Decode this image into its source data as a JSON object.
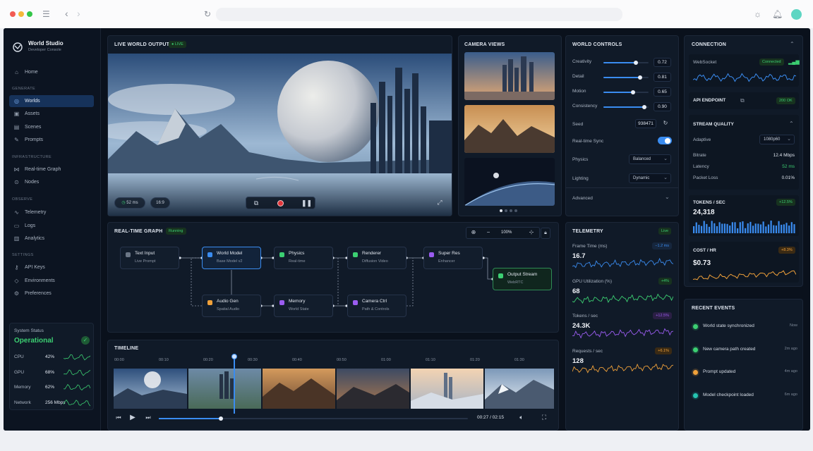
{
  "colors": {
    "accent": "#3a8cf0",
    "success": "#3ccf72",
    "warning": "#f0a13a",
    "purple": "#9a5cf0",
    "teal": "#25c4b0"
  },
  "app": {
    "name": "World Studio",
    "subtitle": "Developer Console"
  },
  "sidebar": {
    "home": "Home",
    "sections": [
      {
        "title": "GENERATE",
        "items": [
          "Worlds",
          "Assets",
          "Scenes",
          "Prompts"
        ]
      },
      {
        "title": "INFRASTRUCTURE",
        "items": [
          "Real-time Graph",
          "Nodes"
        ]
      },
      {
        "title": "OBSERVE",
        "items": [
          "Telemetry",
          "Logs",
          "Analytics"
        ]
      },
      {
        "title": "SETTINGS",
        "items": [
          "API Keys",
          "Environments",
          "Preferences"
        ]
      }
    ],
    "active_item": "Worlds",
    "system_status": {
      "label": "System Status",
      "state": "Operational",
      "metrics": [
        {
          "name": "CPU",
          "value": "42%"
        },
        {
          "name": "GPU",
          "value": "68%"
        },
        {
          "name": "Memory",
          "value": "62%"
        },
        {
          "name": "Network",
          "value": "256 Mbps"
        }
      ]
    }
  },
  "live_output": {
    "title": "LIVE WORLD OUTPUT",
    "badge": "● LIVE",
    "latency": "52 ms",
    "aspect": "16:9"
  },
  "camera_views": {
    "title": "CAMERA VIEWS"
  },
  "world_controls": {
    "title": "WORLD CONTROLS",
    "sliders": [
      {
        "label": "Creativity",
        "value": "0.72",
        "fraction": 0.72
      },
      {
        "label": "Detail",
        "value": "0.81",
        "fraction": 0.81
      },
      {
        "label": "Motion",
        "value": "0.65",
        "fraction": 0.65
      },
      {
        "label": "Consistency",
        "value": "0.90",
        "fraction": 0.9
      }
    ],
    "seed_label": "Seed",
    "seed_value": "938471",
    "sync_label": "Real-time Sync",
    "physics_label": "Physics",
    "physics_value": "Balanced",
    "lighting_label": "Lighting",
    "lighting_value": "Dynamic",
    "advanced_label": "Advanced"
  },
  "connection": {
    "title": "CONNECTION",
    "websocket_label": "WebSocket",
    "websocket_status": "Connected",
    "api_label": "API ENDPOINT",
    "api_status": "200 OK"
  },
  "stream_quality": {
    "title": "STREAM QUALITY",
    "mode": "Adaptive",
    "resolution": "1080p60",
    "rows": [
      {
        "label": "Bitrate",
        "value": "12.4 Mbps"
      },
      {
        "label": "Latency",
        "value": "52 ms"
      },
      {
        "label": "Packet Loss",
        "value": "0.01%"
      }
    ]
  },
  "tokens": {
    "title": "TOKENS / SEC",
    "value": "24,318",
    "delta": "+12.5%"
  },
  "cost": {
    "title": "COST / HR",
    "value": "$0.73",
    "delta": "+8.3%"
  },
  "graph": {
    "title": "REAL-TIME GRAPH",
    "status": "Running",
    "zoom": "100%",
    "nodes": [
      {
        "title": "Text Input",
        "sub": "Live Prompt"
      },
      {
        "title": "World Model",
        "sub": "Base Model v2"
      },
      {
        "title": "Physics",
        "sub": "Real-time"
      },
      {
        "title": "Renderer",
        "sub": "Diffusion Video"
      },
      {
        "title": "Super Res",
        "sub": "Enhancer"
      },
      {
        "title": "Output Stream",
        "sub": "WebRTC"
      },
      {
        "title": "Audio Gen",
        "sub": "Spatial Audio"
      },
      {
        "title": "Memory",
        "sub": "World State"
      },
      {
        "title": "Camera Ctrl",
        "sub": "Path & Controls"
      }
    ]
  },
  "telemetry": {
    "title": "TELEMETRY",
    "status": "Live",
    "metrics": [
      {
        "label": "Frame Time (ms)",
        "value": "16.7",
        "delta": "−1.2 ms"
      },
      {
        "label": "GPU Utilization (%)",
        "value": "68",
        "delta": "+4%"
      },
      {
        "label": "Tokens / sec",
        "value": "24.3K",
        "delta": "+12.5%"
      },
      {
        "label": "Requests / sec",
        "value": "128",
        "delta": "+6.1%"
      }
    ]
  },
  "timeline": {
    "title": "TIMELINE",
    "ticks": [
      "00:00",
      "00:10",
      "00:20",
      "00:30",
      "00:40",
      "00:50",
      "01:00",
      "01:10",
      "01:20",
      "01:30"
    ],
    "time": "00:27 / 02:15",
    "progress": 0.2
  },
  "events": {
    "title": "RECENT EVENTS",
    "items": [
      {
        "text": "World state synchronized",
        "time": "Now"
      },
      {
        "text": "New camera path created",
        "time": "2m ago"
      },
      {
        "text": "Prompt updated",
        "time": "4m ago"
      },
      {
        "text": "Model checkpoint loaded",
        "time": "6m ago"
      }
    ]
  }
}
